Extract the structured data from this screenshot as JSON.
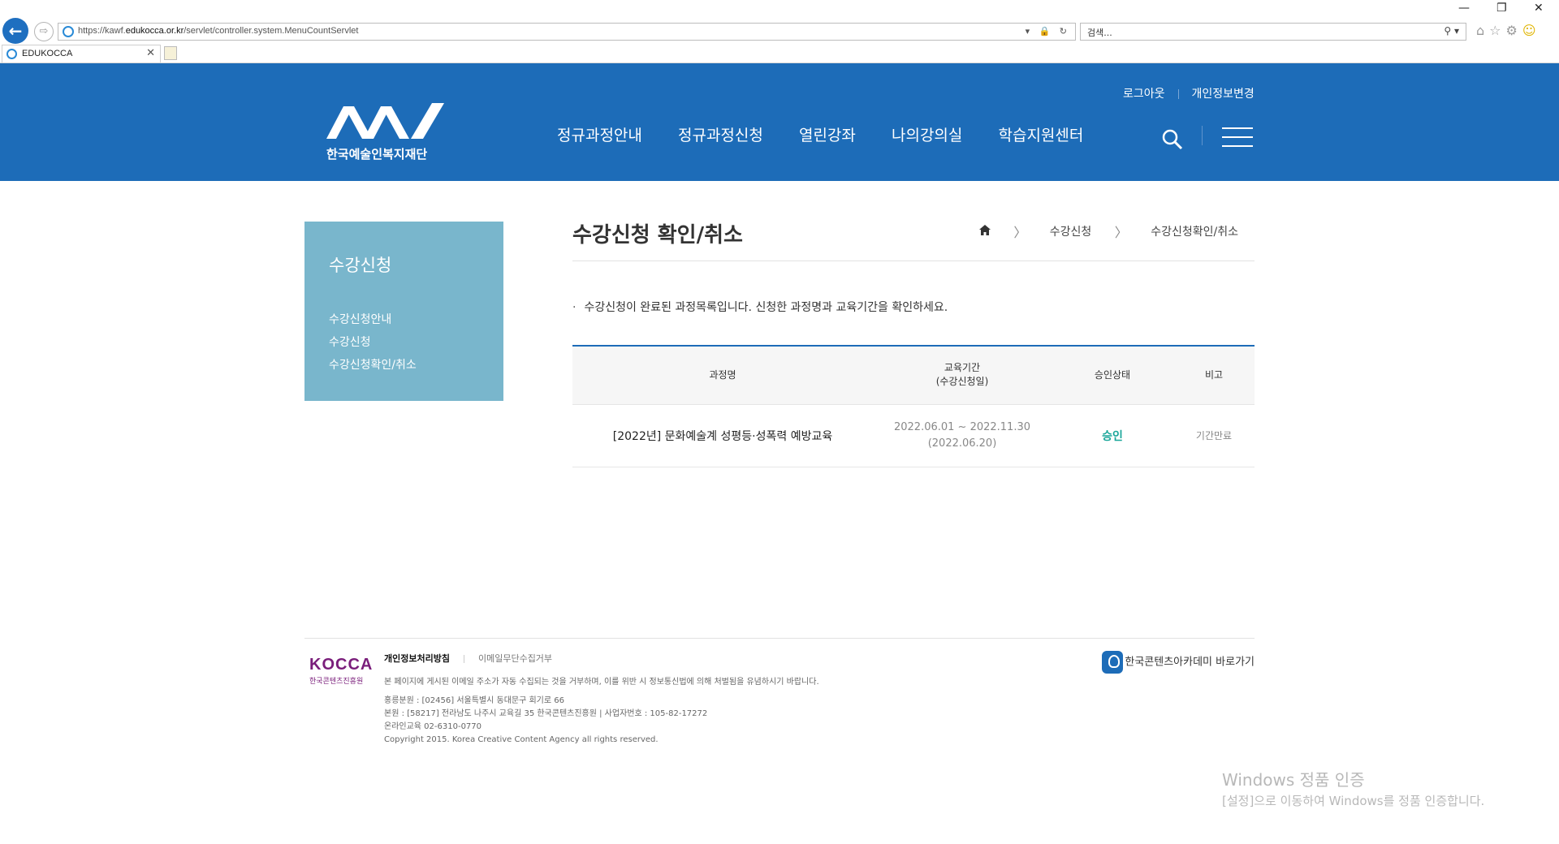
{
  "browser": {
    "url_prefix": "https://kawf.",
    "url_domain": "edukocca.or.kr",
    "url_path": "/servlet/controller.system.MenuCountServlet",
    "search_placeholder": "검색...",
    "tab_title": "EDUKOCCA",
    "addr_tools": "▾ 🔒 ↻",
    "search_tools": "⚲ ▾",
    "win_min": "—",
    "win_restore": "❐",
    "win_close": "✕",
    "tab_close": "✕",
    "back_glyph": "←",
    "fwd_glyph": "⇨",
    "toolbar_icons": [
      "home-icon",
      "favorites-icon",
      "settings-icon",
      "feedback-icon"
    ]
  },
  "header": {
    "util_links": [
      "로그아웃",
      "개인정보변경"
    ],
    "logo_text": "한국예술인복지재단",
    "nav": [
      "정규과정안내",
      "정규과정신청",
      "열린강좌",
      "나의강의실",
      "학습지원센터"
    ],
    "colors": {
      "header_bg": "#1d6cb8"
    }
  },
  "sidebar": {
    "title": "수강신청",
    "items": [
      "수강신청안내",
      "수강신청",
      "수강신청확인/취소"
    ],
    "colors": {
      "bg": "#79b6cc"
    }
  },
  "main": {
    "title": "수강신청 확인/취소",
    "breadcrumb": [
      "수강신청",
      "수강신청확인/취소"
    ],
    "notice": "수강신청이 완료된 과정목록입니다. 신청한 과정명과 교육기간을 확인하세요.",
    "notice_bullet": "·",
    "breadcrumb_sep": "〉",
    "table": {
      "headers": {
        "course": "과정명",
        "period_line1": "교육기간",
        "period_line2": "(수강신청일)",
        "status": "승인상태",
        "note": "비고"
      },
      "rows": [
        {
          "course": "[2022년] 문화예술계 성평등·성폭력 예방교육",
          "period": "2022.06.01 ~ 2022.11.30",
          "applied": "(2022.06.20)",
          "status": "승인",
          "note": "기간만료"
        }
      ]
    }
  },
  "footer": {
    "kocca_logo": "KOCCA",
    "kocca_sub": "한국콘텐츠진흥원",
    "privacy_link": "개인정보처리방침",
    "email_link": "이메일무단수집거부",
    "email_notice": "본 페이지에 게시된 이메일 주소가 자동 수집되는 것을 거부하며, 이를 위반 시 정보통신법에 의해 처벌됨을 유념하시기 바랍니다.",
    "address_lines": [
      "홍릉분원 : [02456] 서울특별시 동대문구 회기로 66",
      "본원 : [58217] 전라남도 나주시 교육길 35 한국콘텐츠진흥원 | 사업자번호 : 105-82-17272",
      "온라인교육 02-6310-0770",
      "Copyright 2015. Korea Creative Content Agency all rights reserved."
    ],
    "academy_link": "한국콘텐츠아카데미 바로가기"
  },
  "watermark": {
    "line1": "Windows 정품 인증",
    "line2": "[설정]으로 이동하여 Windows를 정품 인증합니다."
  }
}
